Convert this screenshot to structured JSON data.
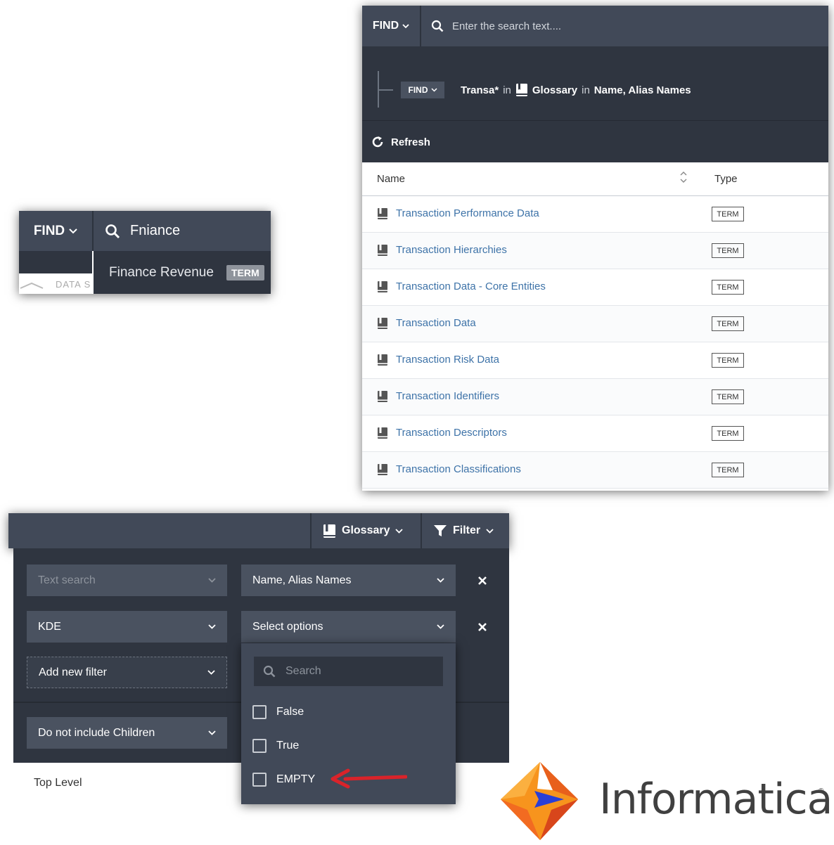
{
  "panel_find": {
    "find_label": "FIND",
    "search_value": "Fniance",
    "suggestion_label": "Finance Revenue",
    "suggestion_tag": "TERM",
    "ghost_text": "DATA S"
  },
  "panel_results": {
    "find_label": "FIND",
    "search_placeholder": "Enter the search text....",
    "criteria_find_label": "FIND",
    "criteria_term": "Transa*",
    "criteria_in1": "in",
    "criteria_scope": "Glossary",
    "criteria_in2": "in",
    "criteria_fields": "Name, Alias Names",
    "refresh_label": "Refresh",
    "columns": {
      "name": "Name",
      "type": "Type"
    },
    "rows": [
      {
        "name": "Transaction Performance Data",
        "type": "TERM"
      },
      {
        "name": "Transaction Hierarchies",
        "type": "TERM"
      },
      {
        "name": "Transaction Data - Core Entities",
        "type": "TERM"
      },
      {
        "name": "Transaction Data",
        "type": "TERM"
      },
      {
        "name": "Transaction Risk Data",
        "type": "TERM"
      },
      {
        "name": "Transaction Identifiers",
        "type": "TERM"
      },
      {
        "name": "Transaction Descriptors",
        "type": "TERM"
      },
      {
        "name": "Transaction Classifications",
        "type": "TERM"
      }
    ]
  },
  "panel_filter": {
    "glossary_label": "Glossary",
    "filter_label": "Filter",
    "text_search_placeholder": "Text search",
    "fields_value": "Name, Alias Names",
    "attribute_value": "KDE",
    "options_value": "Select options",
    "add_filter_label": "Add new filter",
    "children_value": "Do not include Children",
    "level_label": "Top Level",
    "dropdown_search_placeholder": "Search",
    "options": [
      "False",
      "True",
      "EMPTY"
    ]
  },
  "brand": {
    "name": "Informatica",
    "reg_mark": "®"
  },
  "colors": {
    "bar_dark": "#414958",
    "panel_dark": "#2f3540",
    "link_blue": "#3e73a8",
    "arrow_red": "#d9232a",
    "logo_orange": "#f26b21",
    "logo_blue": "#2a3ed6"
  }
}
